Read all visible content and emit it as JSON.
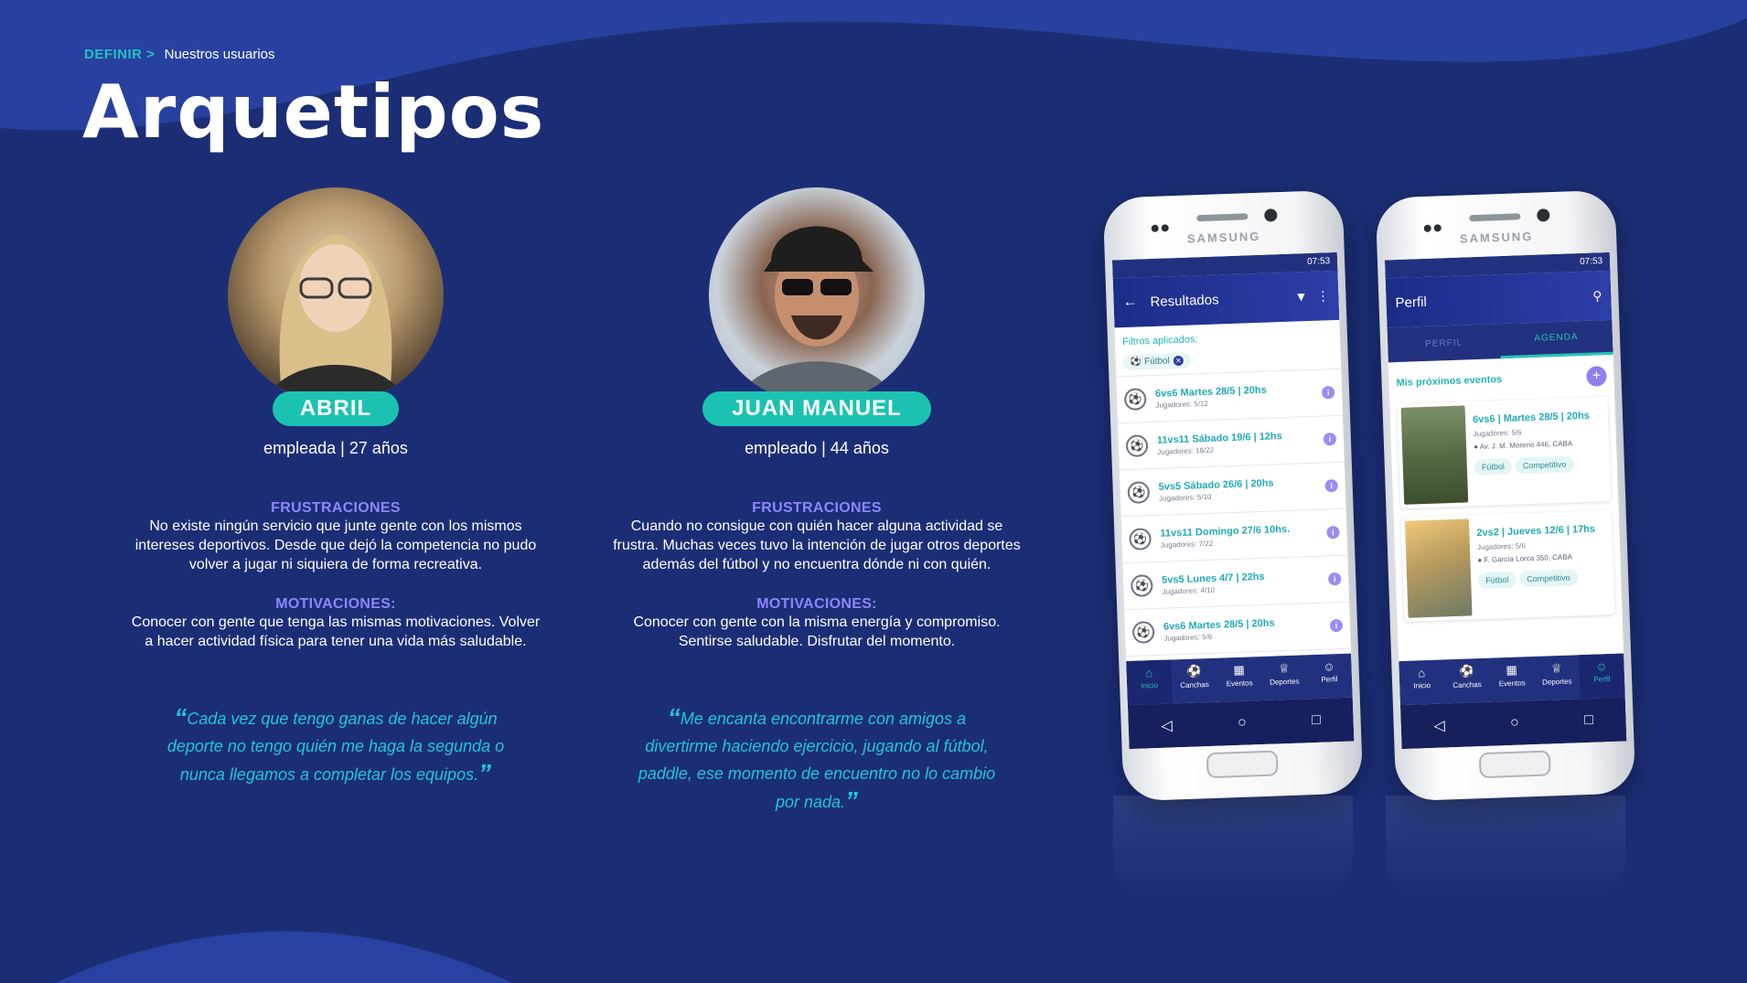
{
  "breadcrumb": {
    "section": "DEFINIR >",
    "page": "Nuestros usuarios"
  },
  "title": "Arquetipos",
  "colors": {
    "background": "#1b2e75",
    "accent": "#1bc2b1",
    "section_heading": "#8d86ff",
    "quote": "#22c6d6"
  },
  "personas": [
    {
      "name": "ABRIL",
      "role": "empleada | 27 años",
      "frustrations_heading": "FRUSTRACIONES",
      "frustrations": "No existe ningún servicio que junte gente con los mismos intereses deportivos. Desde que dejó la competencia no pudo volver a jugar ni siquiera de forma recreativa.",
      "motivations_heading": "MOTIVACIONES:",
      "motivations": "Conocer con gente que tenga las mismas motivaciones. Volver a hacer actividad física para tener una vida más saludable.",
      "quote": "Cada vez que tengo ganas de hacer algún deporte no tengo quién me haga la segunda o nunca llegamos a completar los equipos."
    },
    {
      "name": "JUAN MANUEL",
      "role": "empleado | 44 años",
      "frustrations_heading": "FRUSTRACIONES",
      "frustrations": "Cuando no consigue con quién hacer alguna actividad se frustra. Muchas veces tuvo la intención de jugar otros deportes además del fútbol y no encuentra dónde ni con quién.",
      "motivations_heading": "MOTIVACIONES:",
      "motivations": "Conocer con gente con la misma energía y compromiso. Sentirse saludable. Disfrutar del momento.",
      "quote": "Me encanta encontrarme con amigos a divertirme haciendo ejercicio, jugando al fútbol, paddle, ese momento de encuentro no lo cambio por nada."
    }
  ],
  "quote_open": "“",
  "quote_close": "”",
  "phones": {
    "brand": "SAMSUNG",
    "time": "07:53",
    "results": {
      "title": "Resultados",
      "back_icon": "arrow-left-icon",
      "filter_icon": "filter-icon",
      "more_icon": "more-vert-icon",
      "filters_label": "Filtros aplicados:",
      "chip": "Fútbol",
      "items": [
        {
          "title": "6vs6 Martes 28/5 | 20hs",
          "players": "Jugadores: 5/12"
        },
        {
          "title": "11vs11 Sábado 19/6 | 12hs",
          "players": "Jugadores: 18/22"
        },
        {
          "title": "5vs5 Sábado 26/6 | 20hs",
          "players": "Jugadores: 5/10"
        },
        {
          "title": "11vs11 Domingo 27/6 10hs.",
          "players": "Jugadores: 7/22"
        },
        {
          "title": "5vs5 Lunes 4/7 | 22hs",
          "players": "Jugadores: 4/10"
        },
        {
          "title": "6vs6 Martes 28/5 | 20hs",
          "players": "Jugadores: 5/6"
        }
      ]
    },
    "profile": {
      "title": "Perfil",
      "search_icon": "search-icon",
      "tabs": [
        "PERFIL",
        "AGENDA"
      ],
      "events_label": "Mis próximos eventos",
      "events": [
        {
          "title": "6vs6 | Martes 28/5 | 20hs",
          "players": "Jugadores: 5/6",
          "address": "Av. J. M. Moreno 446, CABA",
          "tags": [
            "Fútbol",
            "Competitivo"
          ]
        },
        {
          "title": "2vs2 | Jueves 12/6 | 17hs",
          "players": "Jugadores: 5/6",
          "address": "F. García Lorca 350, CABA",
          "tags": [
            "Fútbol",
            "Competitivo"
          ]
        }
      ]
    },
    "nav": [
      "Inicio",
      "Canchas",
      "Eventos",
      "Deportes",
      "Perfil"
    ],
    "nav_icons": [
      "home-icon",
      "ball-icon",
      "calendar-icon",
      "trophy-icon",
      "person-icon"
    ]
  }
}
